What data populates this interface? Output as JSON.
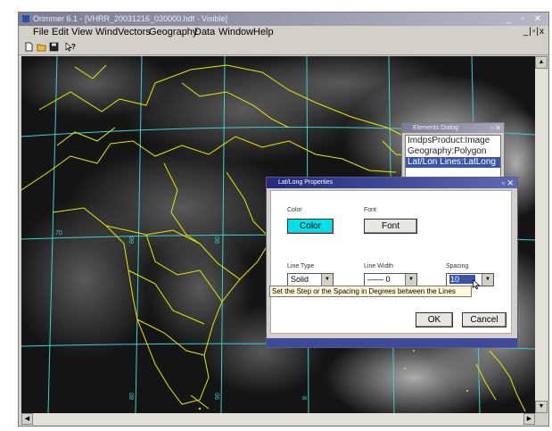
{
  "window": {
    "title": "Orimmer 6.1 - [VHRR_20031216_030000.hdf - Visible]",
    "controls": "_ ▫ ✕"
  },
  "menu": {
    "items": [
      "File",
      "Edit",
      "View",
      "WindVectors",
      "Geography",
      "Data",
      "Window",
      "Help"
    ],
    "mdi_controls": "_|▫|x"
  },
  "toolbar": {
    "icons": [
      "new-file-icon",
      "open-folder-icon",
      "save-icon",
      "help-pointer-icon"
    ]
  },
  "map": {
    "grid_labels": [
      "70",
      "80",
      "90",
      "80",
      "90",
      "8"
    ],
    "colors": {
      "background": "#141414",
      "coastline": "#e8e800",
      "grid": "#3fd0d0"
    }
  },
  "elements_dialog": {
    "title": "Elements Dialog",
    "items": [
      "ImdpsProduct:Image",
      "Geography:Polygon",
      "Lat/Lon Lines:LatLong"
    ],
    "selected_index": 2
  },
  "latlong_dialog": {
    "title": "Lat/Long Properties",
    "color_label": "Color",
    "color_button": "Color",
    "color_value": "#00e0e8",
    "font_label": "Font",
    "font_button": "Font",
    "line_type_label": "Line Type",
    "line_type_value": "Solid",
    "line_width_label": "Line Width",
    "line_width_value": "—— 0",
    "spacing_label": "Spacing",
    "spacing_value": "10",
    "tooltip": "Set the Step or the Spacing in Degrees between the Lines",
    "ok_button": "OK",
    "cancel_button": "Cancel"
  }
}
